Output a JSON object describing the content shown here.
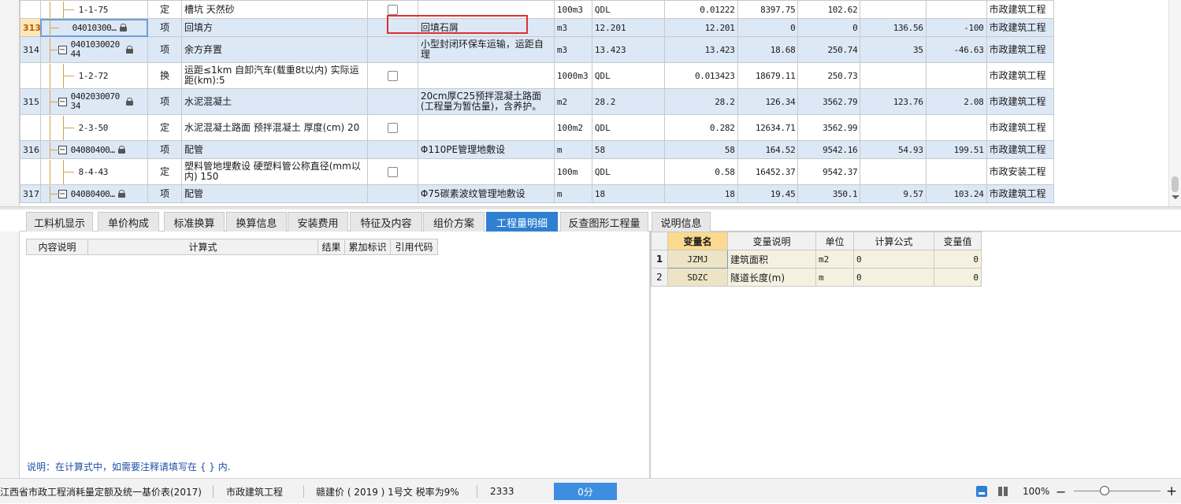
{
  "main_table": {
    "rows": [
      {
        "seq": "",
        "code": "1-1-75",
        "type": "定",
        "name": "槽坑 天然砂",
        "check": true,
        "feature": "",
        "unit": "100m3",
        "qe": "QDL",
        "qty": "0.01222",
        "price": "8397.75",
        "total": "102.62",
        "c1": "",
        "c2": "",
        "major": "市政建筑工程",
        "kind": "child"
      },
      {
        "seq": "313",
        "code": "04010300…",
        "type": "项",
        "name": "回填方",
        "check": false,
        "feature": "回填石屑",
        "unit": "m3",
        "qe": "12.201",
        "qty": "12.201",
        "price": "0",
        "total": "0",
        "c1": "136.56",
        "c2": "-100",
        "major": "市政建筑工程",
        "kind": "item",
        "selected": true
      },
      {
        "seq": "314",
        "code": "040103002044",
        "type": "项",
        "name": "余方弃置",
        "check": false,
        "feature": "小型封闭环保车运输，运距自理",
        "unit": "m3",
        "qe": "13.423",
        "qty": "13.423",
        "price": "18.68",
        "total": "250.74",
        "c1": "35",
        "c2": "-46.63",
        "major": "市政建筑工程",
        "kind": "item"
      },
      {
        "seq": "",
        "code": "1-2-72",
        "type": "换",
        "name": "运距≤1km 自卸汽车(载重8t以内) 实际运距(km):5",
        "check": true,
        "feature": "",
        "unit": "1000m3",
        "qe": "QDL",
        "qty": "0.013423",
        "price": "18679.11",
        "total": "250.73",
        "c1": "",
        "c2": "",
        "major": "市政建筑工程",
        "kind": "child"
      },
      {
        "seq": "315",
        "code": "040203007034",
        "type": "项",
        "name": "水泥混凝土",
        "check": false,
        "feature": "20cm厚C25预拌混凝土路面(工程量为暂估量)，含养护。",
        "unit": "m2",
        "qe": "28.2",
        "qty": "28.2",
        "price": "126.34",
        "total": "3562.79",
        "c1": "123.76",
        "c2": "2.08",
        "major": "市政建筑工程",
        "kind": "item"
      },
      {
        "seq": "",
        "code": "2-3-50",
        "type": "定",
        "name": "水泥混凝土路面 预拌混凝土 厚度(cm) 20",
        "check": true,
        "feature": "",
        "unit": "100m2",
        "qe": "QDL",
        "qty": "0.282",
        "price": "12634.71",
        "total": "3562.99",
        "c1": "",
        "c2": "",
        "major": "市政建筑工程",
        "kind": "child"
      },
      {
        "seq": "316",
        "code": "04080400…",
        "type": "项",
        "name": "配管",
        "check": false,
        "feature": "Φ110PE管理地敷设",
        "unit": "m",
        "qe": "58",
        "qty": "58",
        "price": "164.52",
        "total": "9542.16",
        "c1": "54.93",
        "c2": "199.51",
        "major": "市政建筑工程",
        "kind": "item"
      },
      {
        "seq": "",
        "code": "8-4-43",
        "type": "定",
        "name": "塑料管地埋敷设 硬塑料管公称直径(mm以内) 150",
        "check": true,
        "feature": "",
        "unit": "100m",
        "qe": "QDL",
        "qty": "0.58",
        "price": "16452.37",
        "total": "9542.37",
        "c1": "",
        "c2": "",
        "major": "市政安装工程",
        "kind": "child"
      },
      {
        "seq": "317",
        "code": "04080400…",
        "type": "项",
        "name": "配管",
        "check": false,
        "feature": "Φ75碳素波纹管理地敷设",
        "unit": "m",
        "qe": "18",
        "qty": "18",
        "price": "19.45",
        "total": "350.1",
        "c1": "9.57",
        "c2": "103.24",
        "major": "市政建筑工程",
        "kind": "item"
      }
    ]
  },
  "tabs": [
    {
      "label": "工料机显示"
    },
    {
      "label": "单价构成"
    },
    {
      "label": "标准换算"
    },
    {
      "label": "换算信息"
    },
    {
      "label": "安装费用"
    },
    {
      "label": "特征及内容"
    },
    {
      "label": "组价方案"
    },
    {
      "label": "工程量明细",
      "active": true
    },
    {
      "label": "反查图形工程量"
    },
    {
      "label": "说明信息"
    }
  ],
  "calc_table": {
    "headers": [
      "内容说明",
      "计算式",
      "结果",
      "累加标识",
      "引用代码"
    ]
  },
  "hint": "说明：在计算式中，如需要注释请填写在 { } 内.",
  "var_table": {
    "headers": [
      "变量名",
      "变量说明",
      "单位",
      "计算公式",
      "变量值"
    ],
    "rows": [
      {
        "idx": "1",
        "name": "JZMJ",
        "desc": "建筑面积",
        "unit": "m2",
        "formula": "0",
        "value": "0"
      },
      {
        "idx": "2",
        "name": "SDZC",
        "desc": "隧道长度(m)",
        "unit": "m",
        "formula": "0",
        "value": "0"
      }
    ]
  },
  "status": {
    "quota_lib": "江西省市政工程消耗量定额及统一基价表(2017)",
    "major": "市政建筑工程",
    "tax_doc": "赣建价 ( 2019 ) 1号文 税率为9%",
    "count": "2333",
    "score": "0分",
    "zoom": "100%",
    "zoom_out": "−",
    "zoom_in": "+"
  },
  "colors": {
    "accent": "#2f80d1",
    "row_blue": "#dce8f6",
    "highlight": "#e03030",
    "hint": "#1f4fa8"
  }
}
